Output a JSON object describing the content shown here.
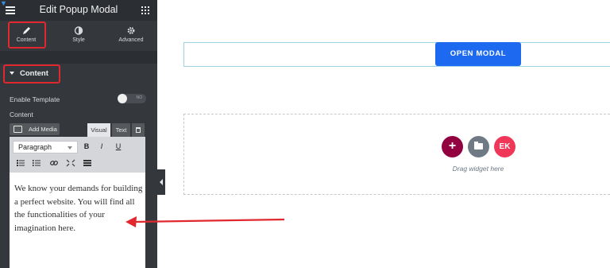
{
  "header": {
    "title": "Edit Popup Modal"
  },
  "tabs": [
    {
      "label": "Content",
      "icon": "pencil-icon"
    },
    {
      "label": "Style",
      "icon": "contrast-icon"
    },
    {
      "label": "Advanced",
      "icon": "gear-icon"
    }
  ],
  "section": {
    "title": "Content"
  },
  "enable_template": {
    "label": "Enable Template",
    "toggle_text": "NO"
  },
  "content_label": "Content",
  "editor": {
    "add_media_label": "Add Media",
    "tab_visual": "Visual",
    "tab_text": "Text",
    "format_value": "Paragraph",
    "bold": "B",
    "italic": "I",
    "underline": "U",
    "body_text": "We know your demands for building a perfect website. You will find all the functionalities of your imagination here."
  },
  "canvas": {
    "open_modal_label": "OPEN MODAL",
    "add_icon": "+",
    "ek_icon": "EK",
    "drag_text": "Drag widget here"
  },
  "colors": {
    "panel_bg": "#34373b",
    "header_bg": "#2b2e32",
    "highlight": "#e0282e",
    "button_blue": "#1d6af0",
    "add_button": "#93003f",
    "folder_button": "#6f7a85",
    "ek_button": "#f0375a"
  }
}
